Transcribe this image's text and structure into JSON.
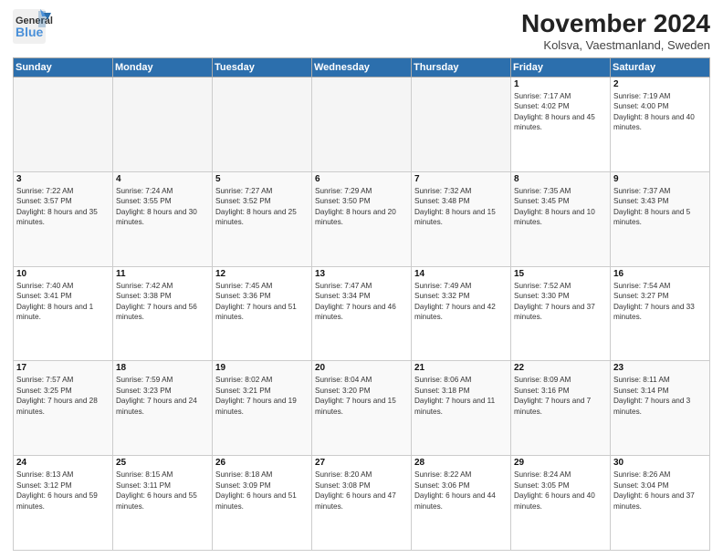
{
  "logo": {
    "line1": "General",
    "line2": "Blue"
  },
  "title": "November 2024",
  "subtitle": "Kolsva, Vaestmanland, Sweden",
  "days_of_week": [
    "Sunday",
    "Monday",
    "Tuesday",
    "Wednesday",
    "Thursday",
    "Friday",
    "Saturday"
  ],
  "weeks": [
    [
      {
        "day": "",
        "info": ""
      },
      {
        "day": "",
        "info": ""
      },
      {
        "day": "",
        "info": ""
      },
      {
        "day": "",
        "info": ""
      },
      {
        "day": "",
        "info": ""
      },
      {
        "day": "1",
        "info": "Sunrise: 7:17 AM\nSunset: 4:02 PM\nDaylight: 8 hours and 45 minutes."
      },
      {
        "day": "2",
        "info": "Sunrise: 7:19 AM\nSunset: 4:00 PM\nDaylight: 8 hours and 40 minutes."
      }
    ],
    [
      {
        "day": "3",
        "info": "Sunrise: 7:22 AM\nSunset: 3:57 PM\nDaylight: 8 hours and 35 minutes."
      },
      {
        "day": "4",
        "info": "Sunrise: 7:24 AM\nSunset: 3:55 PM\nDaylight: 8 hours and 30 minutes."
      },
      {
        "day": "5",
        "info": "Sunrise: 7:27 AM\nSunset: 3:52 PM\nDaylight: 8 hours and 25 minutes."
      },
      {
        "day": "6",
        "info": "Sunrise: 7:29 AM\nSunset: 3:50 PM\nDaylight: 8 hours and 20 minutes."
      },
      {
        "day": "7",
        "info": "Sunrise: 7:32 AM\nSunset: 3:48 PM\nDaylight: 8 hours and 15 minutes."
      },
      {
        "day": "8",
        "info": "Sunrise: 7:35 AM\nSunset: 3:45 PM\nDaylight: 8 hours and 10 minutes."
      },
      {
        "day": "9",
        "info": "Sunrise: 7:37 AM\nSunset: 3:43 PM\nDaylight: 8 hours and 5 minutes."
      }
    ],
    [
      {
        "day": "10",
        "info": "Sunrise: 7:40 AM\nSunset: 3:41 PM\nDaylight: 8 hours and 1 minute."
      },
      {
        "day": "11",
        "info": "Sunrise: 7:42 AM\nSunset: 3:38 PM\nDaylight: 7 hours and 56 minutes."
      },
      {
        "day": "12",
        "info": "Sunrise: 7:45 AM\nSunset: 3:36 PM\nDaylight: 7 hours and 51 minutes."
      },
      {
        "day": "13",
        "info": "Sunrise: 7:47 AM\nSunset: 3:34 PM\nDaylight: 7 hours and 46 minutes."
      },
      {
        "day": "14",
        "info": "Sunrise: 7:49 AM\nSunset: 3:32 PM\nDaylight: 7 hours and 42 minutes."
      },
      {
        "day": "15",
        "info": "Sunrise: 7:52 AM\nSunset: 3:30 PM\nDaylight: 7 hours and 37 minutes."
      },
      {
        "day": "16",
        "info": "Sunrise: 7:54 AM\nSunset: 3:27 PM\nDaylight: 7 hours and 33 minutes."
      }
    ],
    [
      {
        "day": "17",
        "info": "Sunrise: 7:57 AM\nSunset: 3:25 PM\nDaylight: 7 hours and 28 minutes."
      },
      {
        "day": "18",
        "info": "Sunrise: 7:59 AM\nSunset: 3:23 PM\nDaylight: 7 hours and 24 minutes."
      },
      {
        "day": "19",
        "info": "Sunrise: 8:02 AM\nSunset: 3:21 PM\nDaylight: 7 hours and 19 minutes."
      },
      {
        "day": "20",
        "info": "Sunrise: 8:04 AM\nSunset: 3:20 PM\nDaylight: 7 hours and 15 minutes."
      },
      {
        "day": "21",
        "info": "Sunrise: 8:06 AM\nSunset: 3:18 PM\nDaylight: 7 hours and 11 minutes."
      },
      {
        "day": "22",
        "info": "Sunrise: 8:09 AM\nSunset: 3:16 PM\nDaylight: 7 hours and 7 minutes."
      },
      {
        "day": "23",
        "info": "Sunrise: 8:11 AM\nSunset: 3:14 PM\nDaylight: 7 hours and 3 minutes."
      }
    ],
    [
      {
        "day": "24",
        "info": "Sunrise: 8:13 AM\nSunset: 3:12 PM\nDaylight: 6 hours and 59 minutes."
      },
      {
        "day": "25",
        "info": "Sunrise: 8:15 AM\nSunset: 3:11 PM\nDaylight: 6 hours and 55 minutes."
      },
      {
        "day": "26",
        "info": "Sunrise: 8:18 AM\nSunset: 3:09 PM\nDaylight: 6 hours and 51 minutes."
      },
      {
        "day": "27",
        "info": "Sunrise: 8:20 AM\nSunset: 3:08 PM\nDaylight: 6 hours and 47 minutes."
      },
      {
        "day": "28",
        "info": "Sunrise: 8:22 AM\nSunset: 3:06 PM\nDaylight: 6 hours and 44 minutes."
      },
      {
        "day": "29",
        "info": "Sunrise: 8:24 AM\nSunset: 3:05 PM\nDaylight: 6 hours and 40 minutes."
      },
      {
        "day": "30",
        "info": "Sunrise: 8:26 AM\nSunset: 3:04 PM\nDaylight: 6 hours and 37 minutes."
      }
    ]
  ]
}
